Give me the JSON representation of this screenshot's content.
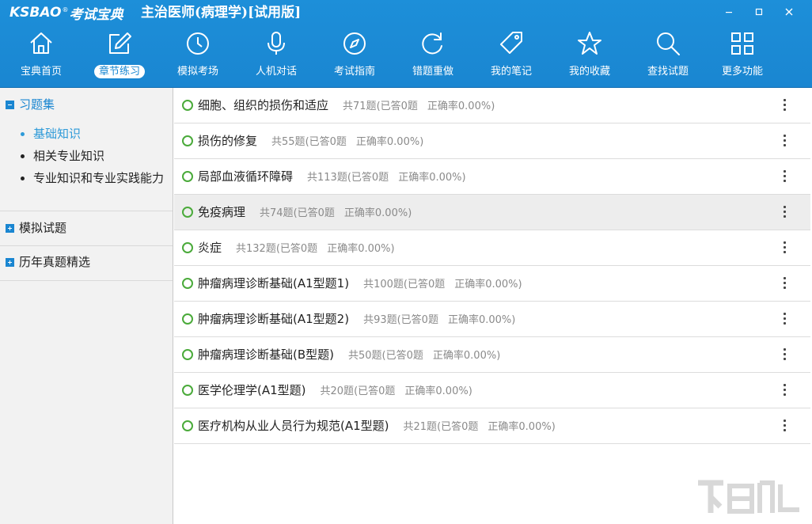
{
  "window": {
    "logo_en": "KSBAO",
    "logo_reg": "®",
    "logo_cn": "考试宝典",
    "title": "主治医师(病理学)[试用版]",
    "controls": [
      "minimize-icon",
      "maximize-icon",
      "close-icon"
    ]
  },
  "nav": {
    "items": [
      {
        "label": "宝典首页",
        "icon": "home-icon"
      },
      {
        "label": "章节练习",
        "icon": "edit-icon"
      },
      {
        "label": "模拟考场",
        "icon": "clock-icon"
      },
      {
        "label": "人机对话",
        "icon": "microphone-icon"
      },
      {
        "label": "考试指南",
        "icon": "compass-icon"
      },
      {
        "label": "错题重做",
        "icon": "refresh-icon"
      },
      {
        "label": "我的笔记",
        "icon": "tag-icon"
      },
      {
        "label": "我的收藏",
        "icon": "star-icon"
      },
      {
        "label": "查找试题",
        "icon": "search-icon"
      },
      {
        "label": "更多功能",
        "icon": "grid-icon"
      }
    ],
    "active_index": 1
  },
  "sidebar": {
    "groups": [
      {
        "title": "习题集",
        "expanded": true,
        "items": [
          "基础知识",
          "相关专业知识",
          "专业知识和专业实践能力"
        ],
        "selected_index": 0
      },
      {
        "title": "模拟试题",
        "expanded": false
      },
      {
        "title": "历年真题精选",
        "expanded": false
      }
    ]
  },
  "chapters": [
    {
      "name": "细胞、组织的损伤和适应",
      "total": "共71题",
      "answered": "(已答0题",
      "accuracy": "正确率0.00%)"
    },
    {
      "name": "损伤的修复",
      "total": "共55题",
      "answered": "(已答0题",
      "accuracy": "正确率0.00%)"
    },
    {
      "name": "局部血液循环障碍",
      "total": "共113题",
      "answered": "(已答0题",
      "accuracy": "正确率0.00%)"
    },
    {
      "name": "免疫病理",
      "total": "共74题",
      "answered": "(已答0题",
      "accuracy": "正确率0.00%)"
    },
    {
      "name": "炎症",
      "total": "共132题",
      "answered": "(已答0题",
      "accuracy": "正确率0.00%)"
    },
    {
      "name": "肿瘤病理诊断基础(A1型题1)",
      "total": "共100题",
      "answered": "(已答0题",
      "accuracy": "正确率0.00%)"
    },
    {
      "name": "肿瘤病理诊断基础(A1型题2)",
      "total": "共93题",
      "answered": "(已答0题",
      "accuracy": "正确率0.00%)"
    },
    {
      "name": "肿瘤病理诊断基础(B型题)",
      "total": "共50题",
      "answered": "(已答0题",
      "accuracy": "正确率0.00%)"
    },
    {
      "name": "医学伦理学(A1型题)",
      "total": "共20题",
      "answered": "(已答0题",
      "accuracy": "正确率0.00%)"
    },
    {
      "name": "医疗机构从业人员行为规范(A1型题)",
      "total": "共21题",
      "answered": "(已答0题",
      "accuracy": "正确率0.00%)"
    }
  ],
  "highlighted_row": 3,
  "colors": {
    "header": "#1a86d1",
    "accent": "#2d9ad8",
    "circle": "#4aaa3a"
  }
}
